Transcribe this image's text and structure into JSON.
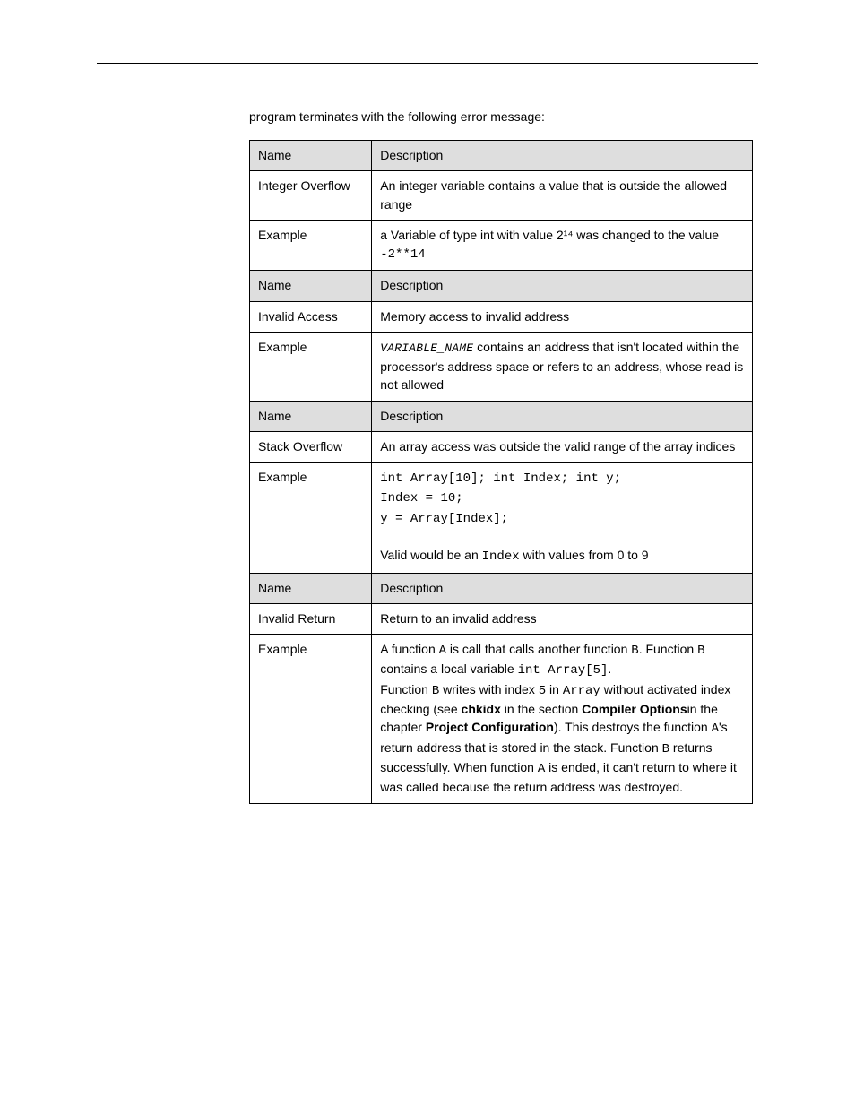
{
  "intro": "program terminates with the following error message:",
  "sections": [
    {
      "header": {
        "name": "Name",
        "desc": "Description"
      },
      "rows": [
        {
          "name": "Integer Overflow",
          "desc": "An integer variable contains a value that is outside the allowed range"
        },
        {
          "name": "Example",
          "desc_pre": "a Variable of type int with value 2¹⁴ was changed to the value ",
          "desc_mono": "-2**14"
        }
      ]
    },
    {
      "header": {
        "name": "Name",
        "desc": "Description"
      },
      "rows": [
        {
          "name": "Invalid Access",
          "desc": "Memory access to invalid address"
        },
        {
          "name": "Example",
          "desc_var_pre": "VARIABLE_NAME",
          "desc_post": " contains an address that isn't located within the processor's address space or refers to an address, whose read is not allowed"
        }
      ]
    },
    {
      "header": {
        "name": "Name",
        "desc": "Description"
      },
      "rows": [
        {
          "name": "Stack Overflow",
          "desc": "An array access was outside the valid range of the array indices"
        },
        {
          "name": "Example",
          "desc_lines": [
            {
              "pre": "int Array[10]; int Index; int y;",
              "mono": true
            },
            {
              "pre": "Index = 10;",
              "mono": true
            },
            {
              "pre": "y = Array[Index];",
              "mono": true
            },
            {
              "pre": "Valid would be an ",
              "mono_inline": "Index",
              "post": " with values from 0 to 9"
            }
          ]
        }
      ]
    },
    {
      "header": {
        "name": "Name",
        "desc": "Description"
      },
      "rows": [
        {
          "name": "Invalid Return",
          "desc": "Return to an invalid address"
        },
        {
          "name": "Example",
          "desc_complex": [
            {
              "type": "plain",
              "text": "A function "
            },
            {
              "type": "mono",
              "text": "A"
            },
            {
              "type": "plain",
              "text": " is call that calls another function "
            },
            {
              "type": "mono",
              "text": "B"
            },
            {
              "type": "plain",
              "text": ". Function "
            },
            {
              "type": "mono",
              "text": "B"
            },
            {
              "type": "plain",
              "text": " contains a local variable "
            },
            {
              "type": "mono",
              "text": "int Array[5]"
            },
            {
              "type": "plain",
              "text": "."
            },
            {
              "type": "br"
            },
            {
              "type": "plain",
              "text": "Function "
            },
            {
              "type": "mono",
              "text": "B"
            },
            {
              "type": "plain",
              "text": " writes with index "
            },
            {
              "type": "mono",
              "text": "5"
            },
            {
              "type": "plain",
              "text": " in "
            },
            {
              "type": "mono",
              "text": "Array"
            },
            {
              "type": "plain",
              "text": " without activated index checking (see "
            },
            {
              "type": "bold",
              "text": "chkidx"
            },
            {
              "type": "plain",
              "text": " in the section "
            },
            {
              "type": "bold",
              "text": "Compiler Options"
            },
            {
              "type": "plain",
              "text": "in the chapter "
            },
            {
              "type": "bold",
              "text": "Project Configuration"
            },
            {
              "type": "plain",
              "text": "). This destroys the function "
            },
            {
              "type": "mono",
              "text": "A"
            },
            {
              "type": "plain",
              "text": "'s return address that is stored in the stack. Function "
            },
            {
              "type": "mono",
              "text": "B"
            },
            {
              "type": "plain",
              "text": " returns successfully. When function "
            },
            {
              "type": "mono",
              "text": "A"
            },
            {
              "type": "plain",
              "text": " is ended, it can't return to where it was called because the return address was destroyed."
            }
          ]
        }
      ]
    }
  ]
}
